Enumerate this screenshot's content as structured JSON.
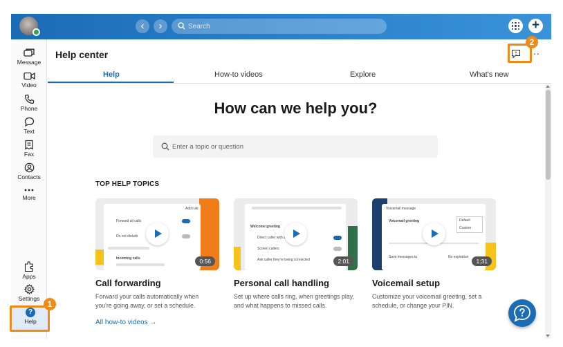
{
  "topbar": {
    "search_placeholder": "Search",
    "back_glyph": "‹",
    "forward_glyph": "›",
    "plus_glyph": "+"
  },
  "sidebar": {
    "items": [
      {
        "label": "Message",
        "icon": "message-icon"
      },
      {
        "label": "Video",
        "icon": "video-icon"
      },
      {
        "label": "Phone",
        "icon": "phone-icon"
      },
      {
        "label": "Text",
        "icon": "text-icon"
      },
      {
        "label": "Fax",
        "icon": "fax-icon"
      },
      {
        "label": "Contacts",
        "icon": "contacts-icon"
      },
      {
        "label": "More",
        "icon": "more-icon"
      },
      {
        "label": "Apps",
        "icon": "apps-icon"
      },
      {
        "label": "Settings",
        "icon": "settings-icon"
      }
    ],
    "help": {
      "label": "Help",
      "glyph": "?"
    }
  },
  "header": {
    "title": "Help center",
    "more_glyph": "···"
  },
  "tabs": [
    "Help",
    "How-to videos",
    "Explore",
    "What's new"
  ],
  "main": {
    "hero": "How can we help you?",
    "search_placeholder": "Enter a topic or question",
    "topics_heading": "TOP HELP TOPICS",
    "all_videos_link": "All how-to videos →"
  },
  "cards": [
    {
      "title": "Call forwarding",
      "description": "Forward your calls automatically when you're going away, or set a schedule.",
      "duration": "0:56",
      "thumb_texts": [
        "Forward all calls",
        "Do not disturb",
        "Incoming calls",
        "Add rule"
      ]
    },
    {
      "title": "Personal call handling",
      "description": "Set up where calls ring, when greetings play, and what happens to missed calls.",
      "duration": "2:01",
      "thumb_texts": [
        "Welcome greeting",
        "Direct caller with an",
        "Screen callers",
        "Ask caller they're being connected"
      ]
    },
    {
      "title": "Voicemail setup",
      "description": "Customize your voicemail greeting, set a schedule, or change your PIN.",
      "duration": "1:31",
      "thumb_texts": [
        "Voicemail message",
        "Voicemail greeting",
        "Default",
        "Custom",
        "Save messages to",
        "No expiration"
      ]
    }
  ],
  "annotations": [
    "1",
    "2"
  ],
  "colors": {
    "brand_blue": "#1b6bb5",
    "annotation_orange": "#f08a16",
    "accent_orange": "#f07d1a",
    "accent_yellow": "#f7c31b",
    "accent_green": "#2f6f4b",
    "accent_navy": "#1d3f6e"
  }
}
